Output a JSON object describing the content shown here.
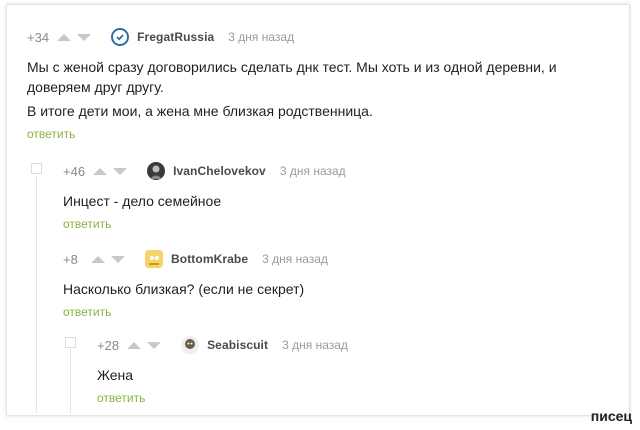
{
  "comments": [
    {
      "rating": "+34",
      "username": "FregatRussia",
      "time": "3 дня назад",
      "text": "Мы с женой сразу договорились сделать днк тест. Мы хоть и из одной деревни, и доверяем друг другу.",
      "text2": "В итоге дети мои, а жена мне близкая родственница.",
      "reply": "ответить"
    },
    {
      "rating": "+46",
      "username": "IvanChelovekov",
      "time": "3 дня назад",
      "text": "Инцест - дело семейное",
      "reply": "ответить"
    },
    {
      "rating": "+8",
      "username": "BottomKrabe",
      "time": "3 дня назад",
      "text": "Насколько близкая? (если не секрет)",
      "reply": "ответить"
    },
    {
      "rating": "+28",
      "username": "Seabiscuit",
      "time": "3 дня назад",
      "text": "Жена",
      "reply": "ответить"
    }
  ],
  "watermark": "писец",
  "colors": {
    "reply": "#8ab33c",
    "verified": "#2f6fa8"
  }
}
